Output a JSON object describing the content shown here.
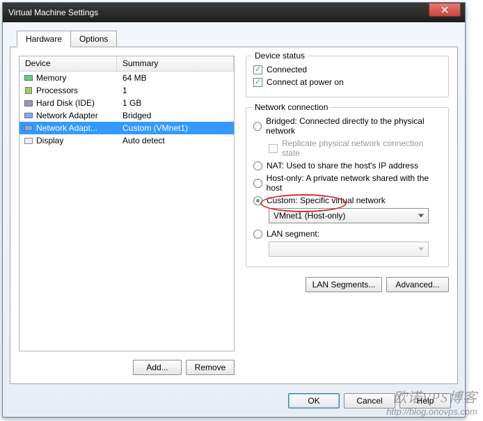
{
  "window": {
    "title": "Virtual Machine Settings"
  },
  "tabs": {
    "hardware": "Hardware",
    "options": "Options"
  },
  "listHeader": {
    "device": "Device",
    "summary": "Summary"
  },
  "devices": [
    {
      "name": "Memory",
      "summary": "64 MB",
      "icon": "ram"
    },
    {
      "name": "Processors",
      "summary": "1",
      "icon": "cpu"
    },
    {
      "name": "Hard Disk (IDE)",
      "summary": "1 GB",
      "icon": "hdd"
    },
    {
      "name": "Network Adapter",
      "summary": "Bridged",
      "icon": "net"
    },
    {
      "name": "Network Adapt...",
      "summary": "Custom (VMnet1)",
      "icon": "net"
    },
    {
      "name": "Display",
      "summary": "Auto detect",
      "icon": "disp"
    }
  ],
  "selectedDeviceIndex": 4,
  "leftButtons": {
    "add": "Add...",
    "remove": "Remove"
  },
  "status": {
    "title": "Device status",
    "connected": "Connected",
    "connectAtPowerOn": "Connect at power on"
  },
  "net": {
    "title": "Network connection",
    "bridged": "Bridged: Connected directly to the physical network",
    "replicate": "Replicate physical network connection state",
    "nat": "NAT: Used to share the host's IP address",
    "hostonly": "Host-only: A private network shared with the host",
    "custom": "Custom: Specific virtual network",
    "customValue": "VMnet1 (Host-only)",
    "lan": "LAN segment:",
    "lanValue": ""
  },
  "rightButtons": {
    "lanSegments": "LAN Segments...",
    "advanced": "Advanced..."
  },
  "footer": {
    "ok": "OK",
    "cancel": "Cancel",
    "help": "Help"
  },
  "watermark": {
    "line1": "欧诺VPS博客",
    "line2": "http://blog.onovps.com"
  }
}
